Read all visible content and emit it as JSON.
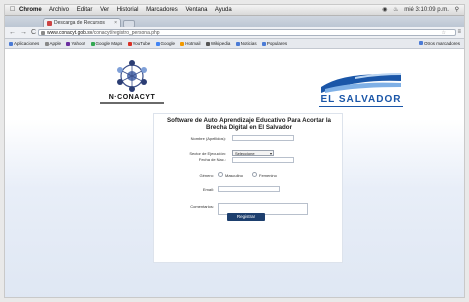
{
  "menubar": {
    "app_name": "Chrome",
    "items": [
      "Archivo",
      "Editar",
      "Ver",
      "Historial",
      "Marcadores",
      "Ventana",
      "Ayuda"
    ],
    "status_text": "mié 3:10:09 p.m."
  },
  "browser": {
    "tab_title": "Descarga de Recursos",
    "url_host": "www.conacyt.gob.sv",
    "url_path": "/conacyt/registro_persona.php",
    "bookmarks": [
      {
        "label": "Aplicaciones",
        "color": "#4b7bd6"
      },
      {
        "label": "Apple",
        "color": "#888888"
      },
      {
        "label": "Yahoo!",
        "color": "#6b2fa0"
      },
      {
        "label": "Google Maps",
        "color": "#34a853"
      },
      {
        "label": "YouTube",
        "color": "#d93025"
      },
      {
        "label": "Google",
        "color": "#4285f4"
      },
      {
        "label": "Hotmail",
        "color": "#f29900"
      },
      {
        "label": "Wikipedia",
        "color": "#555555"
      },
      {
        "label": "Noticias",
        "color": "#4b7bd6"
      },
      {
        "label": "Populares",
        "color": "#4b7bd6"
      }
    ],
    "other_bookmarks": "Otros marcadores"
  },
  "page": {
    "logo_left": "N·CONACYT",
    "logo_right": "EL SALVADOR",
    "title": "Software de Auto Aprendizaje Educativo Para Acortar la Brecha Digital en El Salvador",
    "form": {
      "name_label": "Nombre (Apellidos):",
      "sector_label": "Sector de Ejecución:",
      "sector_value": "Seleccione",
      "birth_label": "Fecha de Nac.:",
      "gender_label": "Género:",
      "male_label": "Masculino",
      "female_label": "Femenino",
      "email_label": "Email:",
      "comments_label": "Comentarios:",
      "submit_label": "Registrar"
    }
  }
}
